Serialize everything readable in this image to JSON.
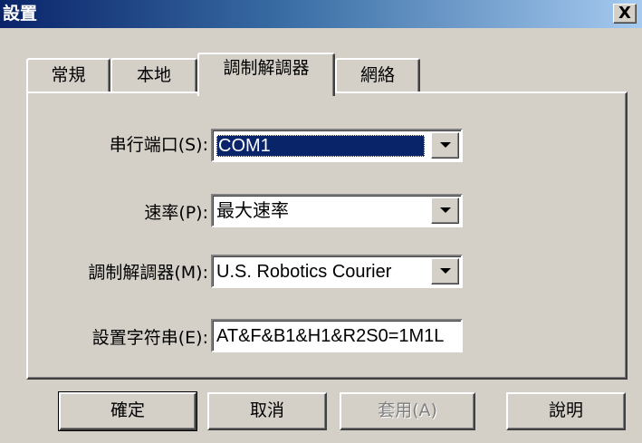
{
  "window": {
    "title": "設置",
    "close_label": "X"
  },
  "tabs": [
    {
      "label": "常規",
      "active": false
    },
    {
      "label": "本地",
      "active": false
    },
    {
      "label": "調制解調器",
      "active": true
    },
    {
      "label": "網絡",
      "active": false
    }
  ],
  "form": {
    "serial_port": {
      "label": "串行端口(S):",
      "value": "COM1"
    },
    "speed": {
      "label": "速率(P):",
      "value": "最大速率"
    },
    "modem": {
      "label": "調制解調器(M):",
      "value": "U.S. Robotics Courier"
    },
    "init_string": {
      "label": "設置字符串(E):",
      "value": "AT&F&B1&H1&R2S0=1M1L"
    }
  },
  "buttons": {
    "ok": "確定",
    "cancel": "取消",
    "apply": "套用(A)",
    "help": "說明"
  },
  "colors": {
    "title_start": "#0a246a",
    "title_end": "#a6caf0",
    "face": "#d4d0c8",
    "selection": "#0a246a"
  }
}
